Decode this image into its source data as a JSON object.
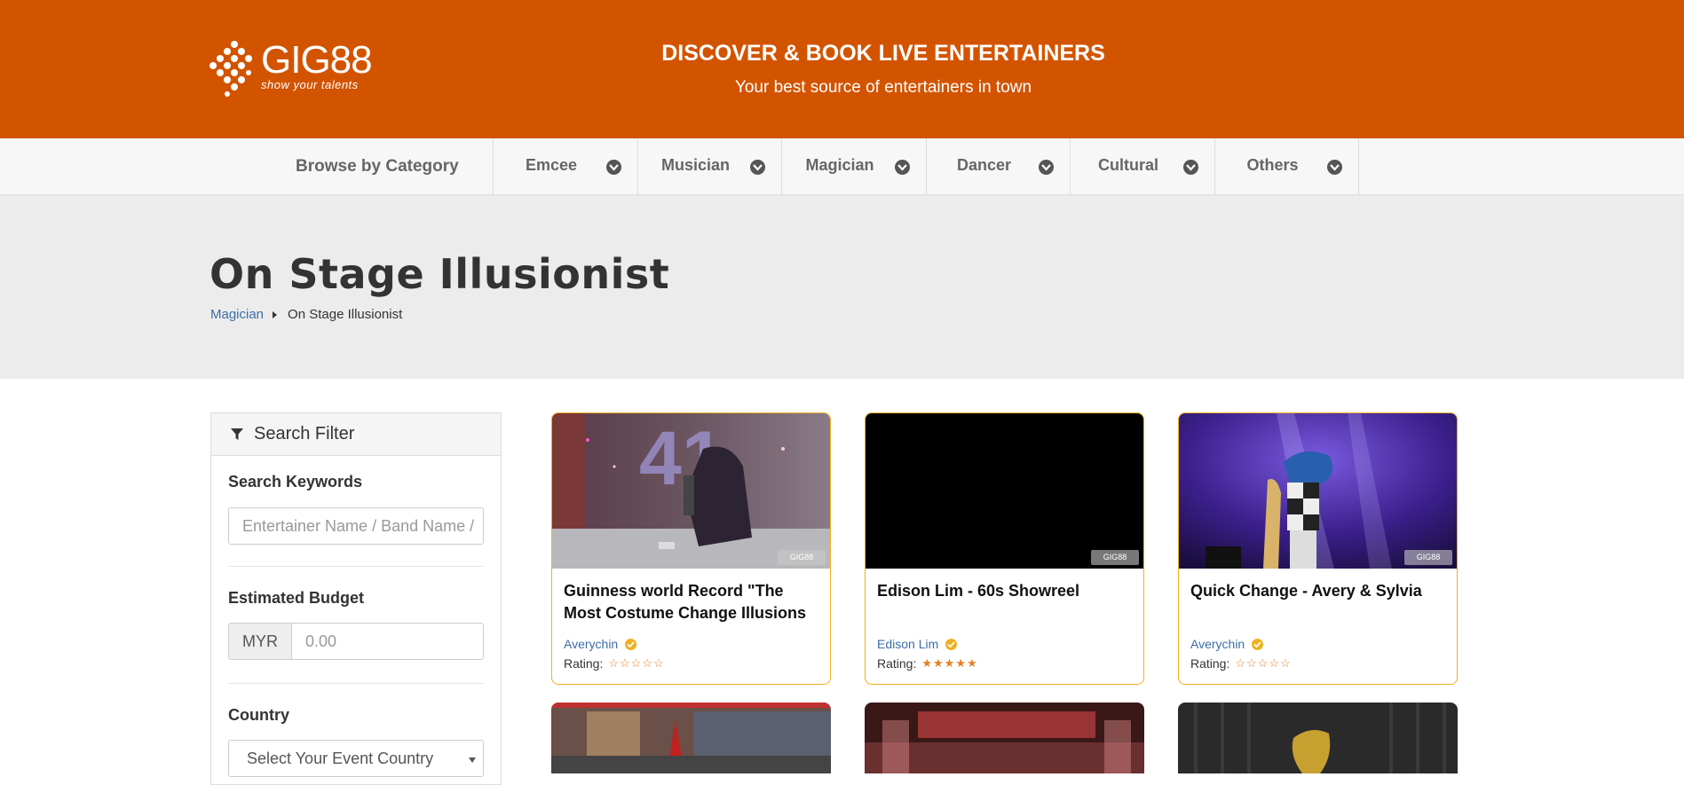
{
  "header": {
    "logo_text": "GIG88",
    "logo_tagline": "show your talents",
    "title": "DISCOVER & BOOK LIVE ENTERTAINERS",
    "subtitle": "Your best source of entertainers in town"
  },
  "catnav": {
    "browse_label": "Browse by Category",
    "items": [
      {
        "label": "Emcee"
      },
      {
        "label": "Musician"
      },
      {
        "label": "Magician"
      },
      {
        "label": "Dancer"
      },
      {
        "label": "Cultural"
      },
      {
        "label": "Others"
      }
    ]
  },
  "page": {
    "title": "On Stage Illusionist",
    "breadcrumb": {
      "parent": "Magician",
      "current": "On Stage Illusionist"
    }
  },
  "filter": {
    "title": "Search Filter",
    "keywords_label": "Search Keywords",
    "keywords_placeholder": "Entertainer Name / Band Name / ",
    "budget_label": "Estimated Budget",
    "currency": "MYR",
    "budget_placeholder": "0.00",
    "country_label": "Country",
    "country_placeholder": "Select Your Event Country"
  },
  "cards": [
    {
      "title": "Guinness world Record \"The Most Costume Change Illusions in One",
      "author": "Averychin",
      "rating_label": "Rating:",
      "rating": 0,
      "stars": "☆☆☆☆☆"
    },
    {
      "title": "Edison Lim - 60s Showreel",
      "author": "Edison Lim",
      "rating_label": "Rating:",
      "rating": 5,
      "stars": "★★★★★"
    },
    {
      "title": "Quick Change - Avery & Sylvia",
      "author": "Averychin",
      "rating_label": "Rating:",
      "rating": 0,
      "stars": "☆☆☆☆☆"
    }
  ],
  "watermark": "GIG88",
  "colors": {
    "brand": "#d35400",
    "card_border": "#f0b020",
    "link": "#3c6ea8",
    "star": "#e67e22"
  }
}
